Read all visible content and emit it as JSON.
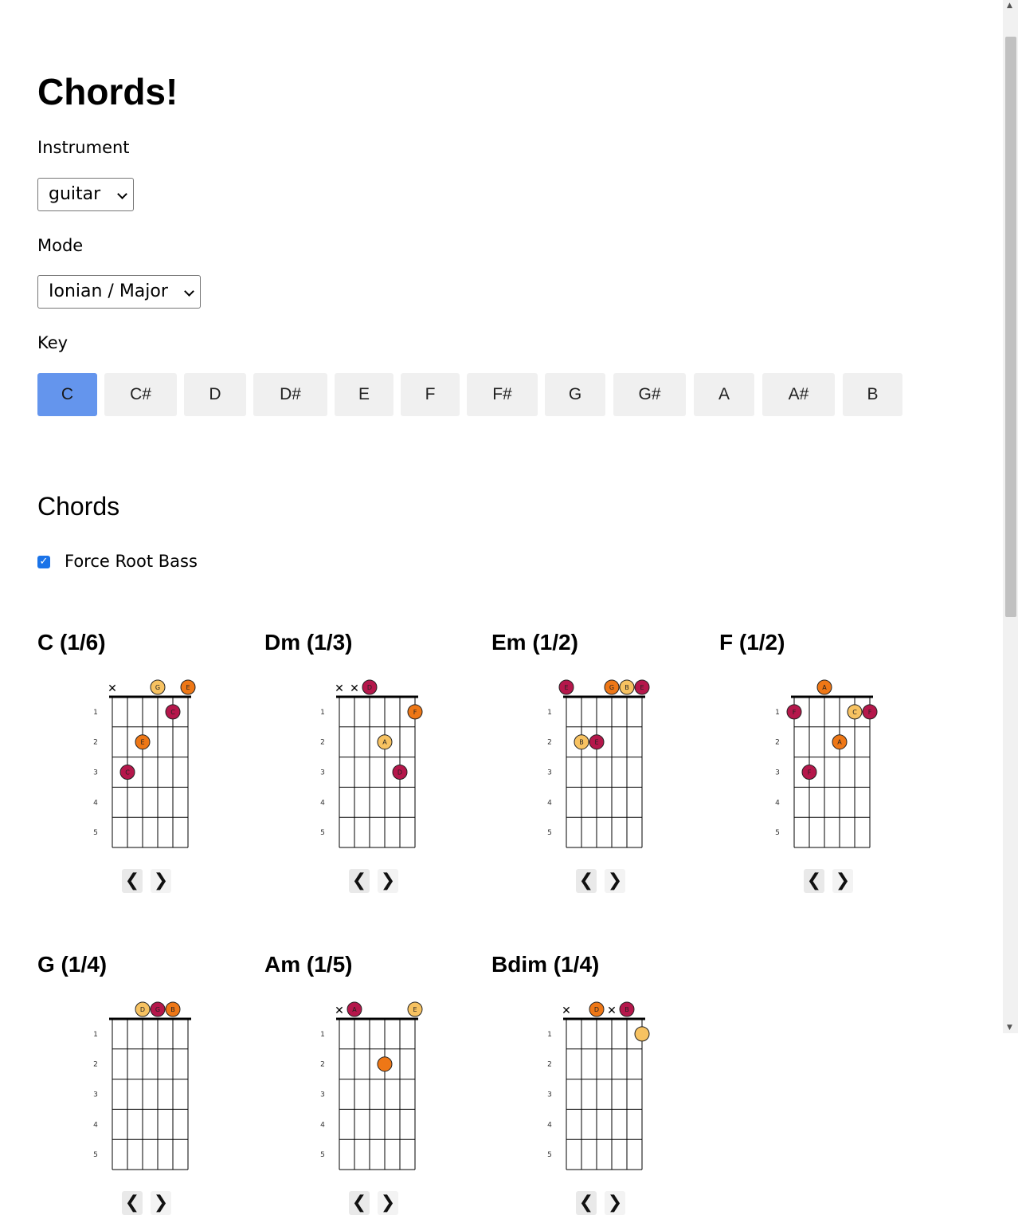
{
  "title": "Chords!",
  "instrument": {
    "label": "Instrument",
    "selected": "guitar"
  },
  "mode": {
    "label": "Mode",
    "selected": "Ionian / Major"
  },
  "key": {
    "label": "Key",
    "options": [
      "C",
      "C#",
      "D",
      "D#",
      "E",
      "F",
      "F#",
      "G",
      "G#",
      "A",
      "A#",
      "B"
    ],
    "selected": "C",
    "active_color": "#6495ed"
  },
  "chords_heading": "Chords",
  "force_root_bass": {
    "label": "Force Root Bass",
    "checked": true
  },
  "nav": {
    "prev": "❮",
    "next": "❯"
  },
  "note_colors": {
    "root": "#b5174b",
    "third": "#ee7716",
    "fifth": "#f7c261"
  },
  "fret_numbers": [
    "1",
    "2",
    "3",
    "4",
    "5"
  ],
  "chords": [
    {
      "title": "C (1/6)",
      "strings": [
        {
          "mute": true
        },
        {
          "fret": 3,
          "note": "C",
          "role": "root"
        },
        {
          "fret": 2,
          "note": "E",
          "role": "third"
        },
        {
          "fret": 0,
          "note": "G",
          "role": "fifth"
        },
        {
          "fret": 1,
          "note": "C",
          "role": "root"
        },
        {
          "fret": 0,
          "note": "E",
          "role": "third"
        }
      ]
    },
    {
      "title": "Dm (1/3)",
      "strings": [
        {
          "mute": true
        },
        {
          "mute": true
        },
        {
          "fret": 0,
          "note": "D",
          "role": "root"
        },
        {
          "fret": 2,
          "note": "A",
          "role": "fifth"
        },
        {
          "fret": 3,
          "note": "D",
          "role": "root"
        },
        {
          "fret": 1,
          "note": "F",
          "role": "third"
        }
      ]
    },
    {
      "title": "Em (1/2)",
      "strings": [
        {
          "fret": 0,
          "note": "E",
          "role": "root"
        },
        {
          "fret": 2,
          "note": "B",
          "role": "fifth"
        },
        {
          "fret": 2,
          "note": "E",
          "role": "root"
        },
        {
          "fret": 0,
          "note": "G",
          "role": "third"
        },
        {
          "fret": 0,
          "note": "B",
          "role": "fifth"
        },
        {
          "fret": 0,
          "note": "E",
          "role": "root"
        }
      ]
    },
    {
      "title": "F (1/2)",
      "strings": [
        {
          "fret": 1,
          "note": "F",
          "role": "root"
        },
        {
          "fret": 3,
          "note": "F",
          "role": "root"
        },
        {
          "fret": 0,
          "note": "A",
          "role": "third"
        },
        {
          "fret": 2,
          "note": "A",
          "role": "third"
        },
        {
          "fret": 1,
          "note": "C",
          "role": "fifth"
        },
        {
          "fret": 1,
          "note": "F",
          "role": "root"
        }
      ]
    },
    {
      "title": "G (1/4)",
      "strings": [
        {
          "fret": null
        },
        {
          "fret": null
        },
        {
          "fret": 0,
          "note": "D",
          "role": "fifth"
        },
        {
          "fret": 0,
          "note": "G",
          "role": "root"
        },
        {
          "fret": 0,
          "note": "B",
          "role": "third"
        },
        {
          "fret": null
        }
      ]
    },
    {
      "title": "Am (1/5)",
      "strings": [
        {
          "mute": true
        },
        {
          "fret": 0,
          "note": "A",
          "role": "root"
        },
        {
          "fret": null
        },
        {
          "fret": 2,
          "note": "",
          "role": "third"
        },
        {
          "fret": null
        },
        {
          "fret": 0,
          "note": "E",
          "role": "fifth"
        }
      ]
    },
    {
      "title": "Bdim (1/4)",
      "strings": [
        {
          "mute": true
        },
        {
          "fret": null
        },
        {
          "fret": 0,
          "note": "D",
          "role": "third"
        },
        {
          "mute": true
        },
        {
          "fret": 0,
          "note": "B",
          "role": "root"
        },
        {
          "fret": 1,
          "note": "",
          "role": "fifth"
        }
      ]
    }
  ]
}
